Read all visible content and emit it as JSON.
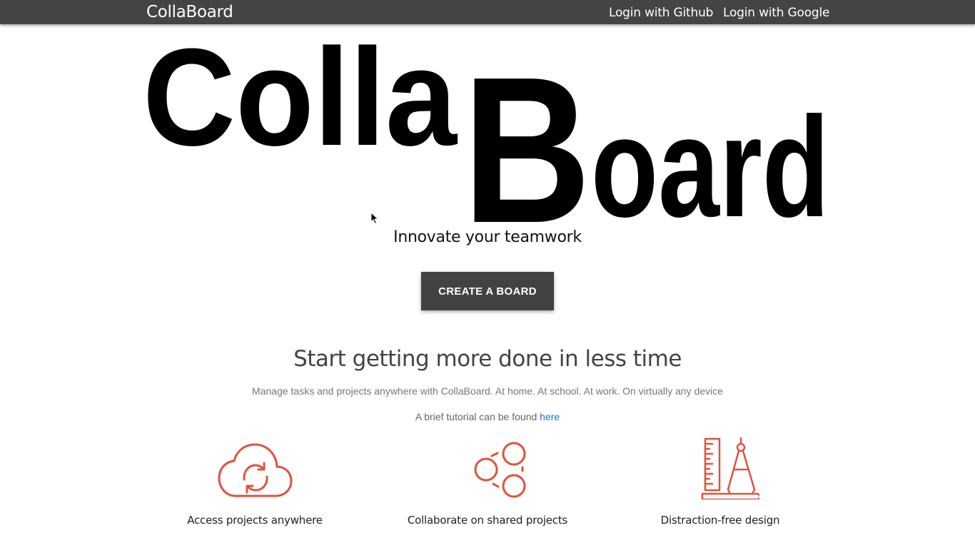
{
  "navbar": {
    "brand": "CollaBoard",
    "links": [
      "Login with Github",
      "Login with Google"
    ]
  },
  "hero": {
    "logo_part1": "Colla",
    "logo_part2": "B",
    "logo_part3": "oard",
    "tagline": "Innovate your teamwork",
    "create_button": "CREATE A BOARD"
  },
  "intro": {
    "headline": "Start getting more done in less time",
    "subline": "Manage tasks and projects anywhere with CollaBoard. At home. At school. At work. On virtually any device",
    "tutorial_text": "A brief tutorial can be found ",
    "tutorial_link": "here"
  },
  "features": [
    {
      "label": "Access projects anywhere",
      "icon": "cloud-sync-icon"
    },
    {
      "label": "Collaborate on shared projects",
      "icon": "share-icon"
    },
    {
      "label": "Distraction-free design",
      "icon": "ruler-compass-icon"
    }
  ],
  "colors": {
    "navbar": "#444444",
    "button": "#424242",
    "icon_accent": "#e0533d",
    "link": "#1976d2"
  }
}
